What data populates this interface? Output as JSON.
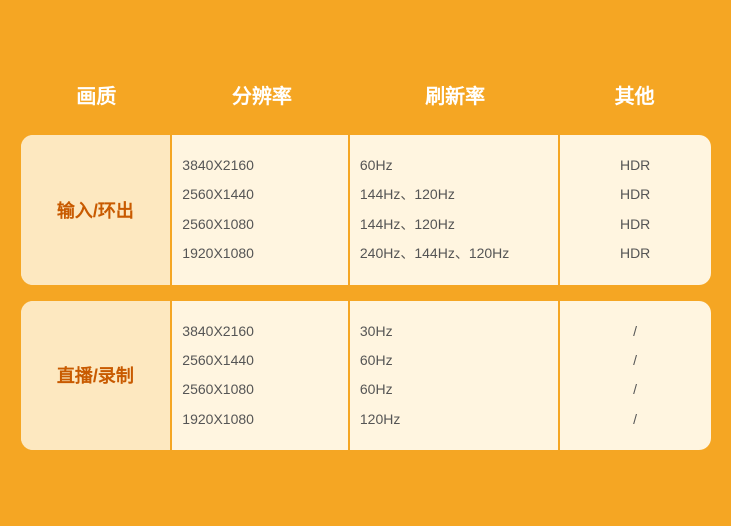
{
  "header": {
    "col1": "画质",
    "col2": "分辨率",
    "col3": "刷新率",
    "col4": "其他"
  },
  "rows": [
    {
      "quality": "输入/环出",
      "resolutions": [
        "3840X2160",
        "2560X1440",
        "2560X1080",
        "1920X1080"
      ],
      "refreshRates": [
        "60Hz",
        "144Hz、120Hz",
        "144Hz、120Hz",
        "240Hz、144Hz、120Hz"
      ],
      "others": [
        "HDR",
        "HDR",
        "HDR",
        "HDR"
      ]
    },
    {
      "quality": "直播/录制",
      "resolutions": [
        "3840X2160",
        "2560X1440",
        "2560X1080",
        "1920X1080"
      ],
      "refreshRates": [
        "30Hz",
        "60Hz",
        "60Hz",
        "120Hz"
      ],
      "others": [
        "/",
        "/",
        "/",
        "/"
      ]
    }
  ],
  "colors": {
    "background": "#f5a623",
    "rowBackground": "#fff5e0",
    "qualityCellBg": "#fde8c0",
    "qualityCellText": "#c85a00",
    "headerText": "#ffffff",
    "dataText": "#555555"
  }
}
